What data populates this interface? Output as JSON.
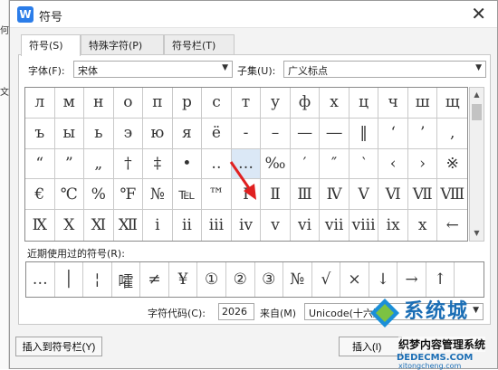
{
  "background": {
    "side_chars": [
      "何",
      "文"
    ]
  },
  "dialog": {
    "title": "符号",
    "app_icon_letter": "W",
    "close_glyph": "✕",
    "accent_color": "#2b7de9",
    "tabs": [
      {
        "label": "符号(S)",
        "active": true
      },
      {
        "label": "特殊字符(P)",
        "active": false
      },
      {
        "label": "符号栏(T)",
        "active": false
      }
    ]
  },
  "symbols": {
    "font_label": "字体(F):",
    "font_value": "宋体",
    "subset_label": "子集(U):",
    "subset_value": "广义标点",
    "grid": [
      [
        "л",
        "м",
        "н",
        "о",
        "п",
        "р",
        "с",
        "т",
        "у",
        "ф",
        "х",
        "ц",
        "ч",
        "ш",
        "щ"
      ],
      [
        "ъ",
        "ы",
        "ь",
        "э",
        "ю",
        "я",
        "ё",
        "‐",
        "–",
        "—",
        "―",
        "‖",
        "‘",
        "’",
        ","
      ],
      [
        "“",
        "”",
        "„",
        "†",
        "‡",
        "•",
        "‥",
        "…",
        "‰",
        "′",
        "″",
        "‵",
        "‹",
        "›",
        "※"
      ],
      [
        "€",
        "℃",
        "%",
        "℉",
        "№",
        "℡",
        "™",
        "Ⅰ",
        "Ⅱ",
        "Ⅲ",
        "Ⅳ",
        "Ⅴ",
        "Ⅵ",
        "Ⅶ",
        "Ⅷ"
      ],
      [
        "Ⅸ",
        "Ⅹ",
        "Ⅺ",
        "Ⅻ",
        "ⅰ",
        "ⅱ",
        "ⅲ",
        "ⅳ",
        "ⅴ",
        "ⅵ",
        "ⅶ",
        "ⅷ",
        "ⅸ",
        "ⅹ",
        "←"
      ]
    ],
    "selected_row": 2,
    "selected_col": 7,
    "recent_label": "近期使用过的符号(R):",
    "recent": [
      "…",
      "│",
      "¦",
      "嚯",
      "≠",
      "¥",
      "①",
      "②",
      "③",
      "№",
      "√",
      "×",
      "↓",
      "→",
      "↑",
      ""
    ]
  },
  "footer": {
    "code_label": "字符代码(C):",
    "code_value": "2026",
    "from_label": "来自(M)",
    "from_value": "Unicode(十六进制)",
    "insert_bar_button": "插入到符号栏(Y)",
    "insert_button": "插入(I)"
  },
  "watermark": {
    "brand": "系统城",
    "line1": "织梦内容管理系统",
    "line2": "DEDECMS.COM",
    "line3": "xitongcheng.com"
  }
}
